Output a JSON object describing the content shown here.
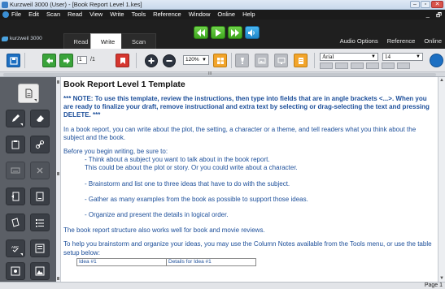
{
  "window": {
    "title": "Kurzweil 3000 (User) - [Book Report Level 1.kes]"
  },
  "menubar": {
    "items": [
      "File",
      "Edit",
      "Scan",
      "Read",
      "View",
      "Write",
      "Tools",
      "Reference",
      "Window",
      "Online",
      "Help"
    ]
  },
  "tabbar": {
    "logo": "kurzweil 3000",
    "tabs": [
      "Read",
      "Write",
      "Scan"
    ],
    "active_tab": "Write",
    "right_links": [
      "Audio Options",
      "Reference",
      "Online"
    ]
  },
  "toolbar": {
    "page_value": "1",
    "page_count": "/1",
    "zoom": "120%",
    "font_name": "Arial",
    "font_size": "14"
  },
  "document": {
    "title": "Book Report Level 1  Template",
    "note": "*** NOTE: To use this template, review the instructions, then type into fields that are in angle brackets <...>. When you are ready to finalize your draft, remove instructional and extra text by selecting or drag-selecting the text and pressing DELETE. ***",
    "intro": "In a book report, you can write about the plot, the setting, a character or a theme, and tell readers what you think about the subject and the book.",
    "before": "Before you begin writing, be sure to:",
    "step1a": "- Think about a subject you want to talk about in the book report.",
    "step1b": "This could be about the plot or story. Or you could write about a character.",
    "step2": "- Brainstorm and list one to three ideas that have to do with the subject.",
    "step3": "- Gather as many examples from the book as possible to support those ideas.",
    "step4": "- Organize and present the details in logical order.",
    "structure": "The book report structure also works well for book and movie reviews.",
    "brainstorm": "To help you brainstorm and organize your ideas, you may use the Column Notes available from the Tools menu, or use the table setup below:",
    "table_headers": [
      "Idea #1",
      "Details for Idea #1"
    ]
  },
  "ruler": {
    "marker": "III"
  },
  "status": {
    "page": "Page 1"
  }
}
